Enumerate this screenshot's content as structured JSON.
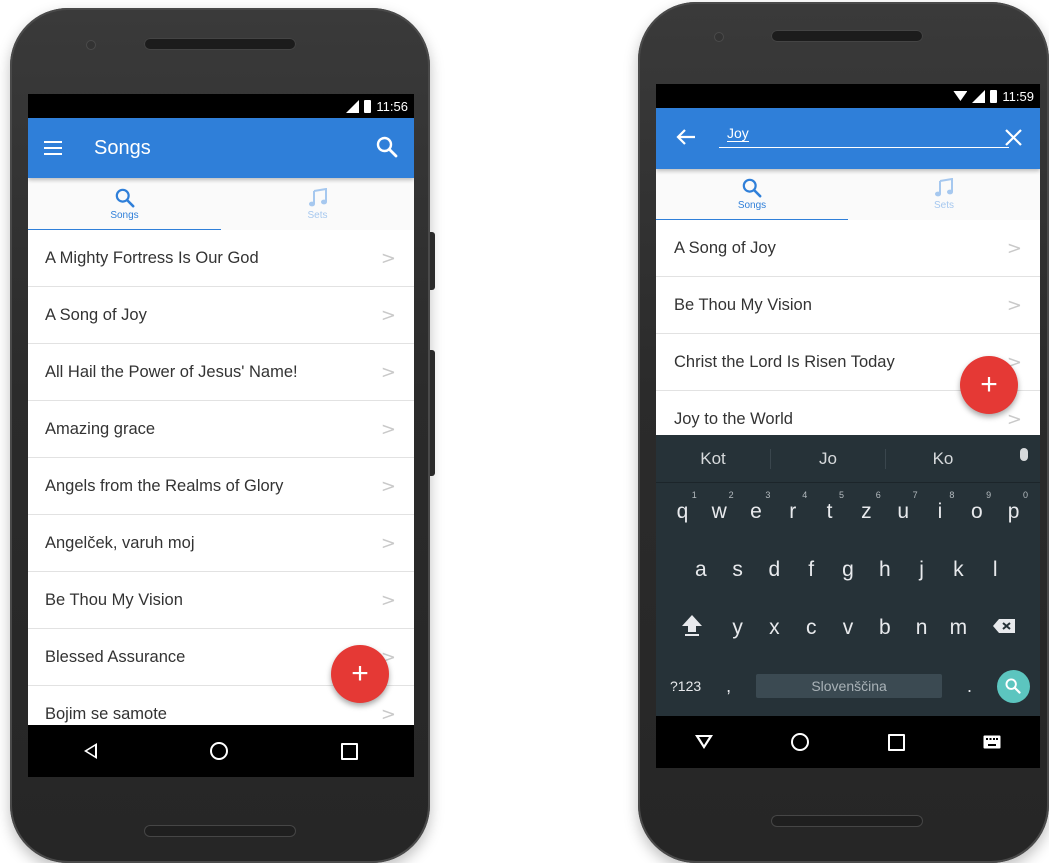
{
  "left_phone": {
    "status_time": "11:56",
    "toolbar_title": "Songs",
    "tabs": [
      {
        "label": "Songs"
      },
      {
        "label": "Sets"
      }
    ],
    "songs": [
      "A Mighty Fortress Is Our God",
      "A Song of Joy",
      "All Hail the Power of Jesus' Name!",
      "Amazing grace",
      "Angels from the Realms of Glory",
      "Angelček, varuh moj",
      "Be Thou My Vision",
      "Blessed Assurance",
      "Bojim se samote"
    ],
    "fab_label": "+"
  },
  "right_phone": {
    "status_time": "11:59",
    "search_value": "Joy",
    "tabs": [
      {
        "label": "Songs"
      },
      {
        "label": "Sets"
      }
    ],
    "results": [
      "A Song of Joy",
      "Be Thou My Vision",
      "Christ the Lord Is Risen Today",
      "Joy to the World"
    ],
    "fab_label": "+",
    "keyboard": {
      "suggestions": [
        "Kot",
        "Jo",
        "Ko"
      ],
      "row1": [
        {
          "key": "q",
          "hint": "1"
        },
        {
          "key": "w",
          "hint": "2"
        },
        {
          "key": "e",
          "hint": "3"
        },
        {
          "key": "r",
          "hint": "4"
        },
        {
          "key": "t",
          "hint": "5"
        },
        {
          "key": "z",
          "hint": "6"
        },
        {
          "key": "u",
          "hint": "7"
        },
        {
          "key": "i",
          "hint": "8"
        },
        {
          "key": "o",
          "hint": "9"
        },
        {
          "key": "p",
          "hint": "0"
        }
      ],
      "row2": [
        "a",
        "s",
        "d",
        "f",
        "g",
        "h",
        "j",
        "k",
        "l"
      ],
      "row3": [
        "y",
        "x",
        "c",
        "v",
        "b",
        "n",
        "m"
      ],
      "symbols_key": "?123",
      "comma_key": ",",
      "space_label": "Slovenščina",
      "period_key": "."
    }
  },
  "colors": {
    "toolbar": "#2f7fd9",
    "fab": "#e53935",
    "keyboard_bg": "#263238",
    "search_key": "#5cc5bf"
  }
}
